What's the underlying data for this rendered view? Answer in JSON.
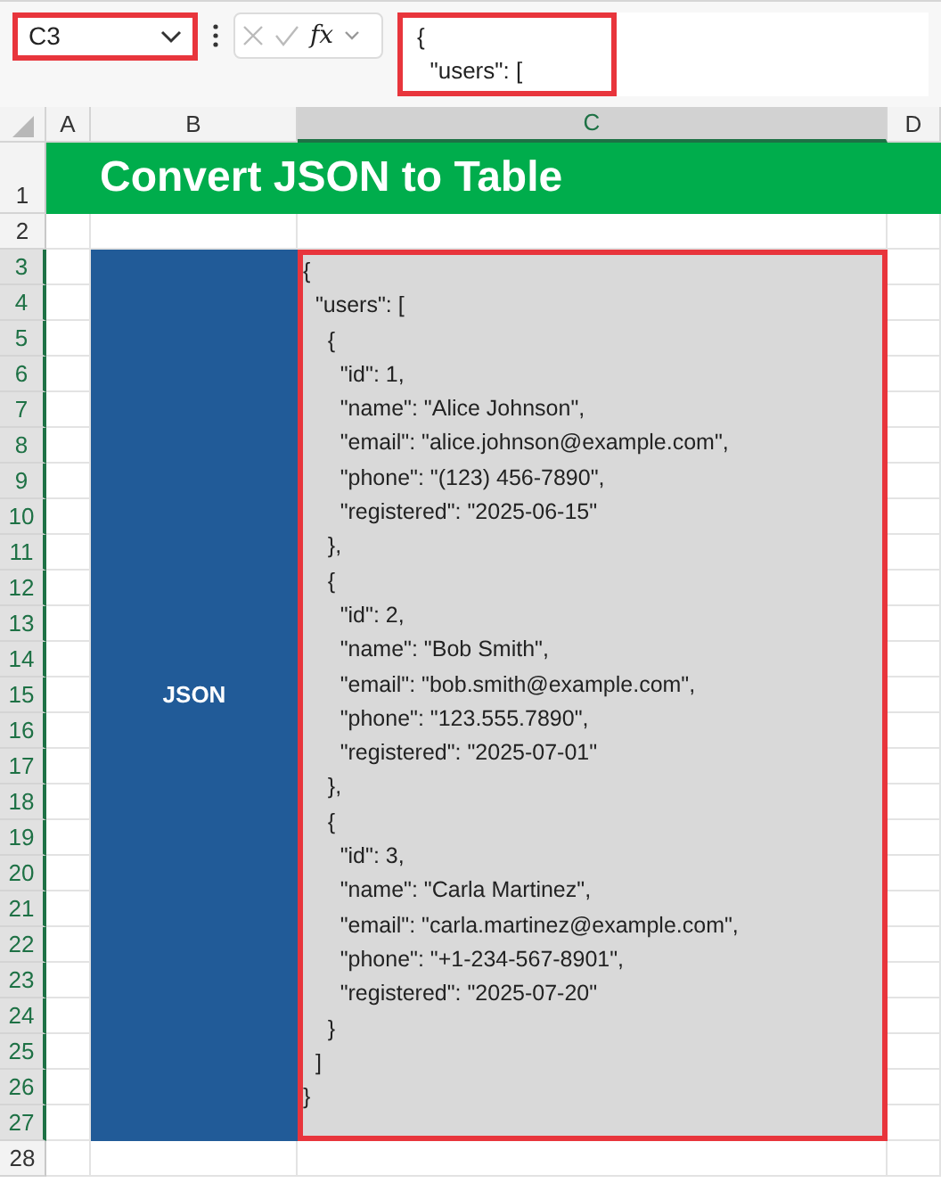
{
  "name_box": {
    "value": "C3"
  },
  "formula_bar": {
    "function_label": "fx",
    "lines": [
      "{",
      "  \"users\": ["
    ]
  },
  "column_headers": [
    {
      "label": "A",
      "selected": false
    },
    {
      "label": "B",
      "selected": false
    },
    {
      "label": "C",
      "selected": true
    },
    {
      "label": "D",
      "selected": false
    }
  ],
  "row_headers": [
    {
      "label": "1",
      "selected": false
    },
    {
      "label": "2",
      "selected": false
    },
    {
      "label": "3",
      "selected": true
    },
    {
      "label": "4",
      "selected": true
    },
    {
      "label": "5",
      "selected": true
    },
    {
      "label": "6",
      "selected": true
    },
    {
      "label": "7",
      "selected": true
    },
    {
      "label": "8",
      "selected": true
    },
    {
      "label": "9",
      "selected": true
    },
    {
      "label": "10",
      "selected": true
    },
    {
      "label": "11",
      "selected": true
    },
    {
      "label": "12",
      "selected": true
    },
    {
      "label": "13",
      "selected": true
    },
    {
      "label": "14",
      "selected": true
    },
    {
      "label": "15",
      "selected": true
    },
    {
      "label": "16",
      "selected": true
    },
    {
      "label": "17",
      "selected": true
    },
    {
      "label": "18",
      "selected": true
    },
    {
      "label": "19",
      "selected": true
    },
    {
      "label": "20",
      "selected": true
    },
    {
      "label": "21",
      "selected": true
    },
    {
      "label": "22",
      "selected": true
    },
    {
      "label": "23",
      "selected": true
    },
    {
      "label": "24",
      "selected": true
    },
    {
      "label": "25",
      "selected": true
    },
    {
      "label": "26",
      "selected": true
    },
    {
      "label": "27",
      "selected": true
    },
    {
      "label": "28",
      "selected": false
    }
  ],
  "title": "Convert JSON to Table",
  "label_cell": "JSON",
  "json_cell": {
    "selected": true,
    "lines": [
      "{",
      "  \"users\": [",
      "    {",
      "      \"id\": 1,",
      "      \"name\": \"Alice Johnson\",",
      "      \"email\": \"alice.johnson@example.com\",",
      "      \"phone\": \"(123) 456-7890\",",
      "      \"registered\": \"2025-06-15\"",
      "    },",
      "    {",
      "      \"id\": 2,",
      "      \"name\": \"Bob Smith\",",
      "      \"email\": \"bob.smith@example.com\",",
      "      \"phone\": \"123.555.7890\",",
      "      \"registered\": \"2025-07-01\"",
      "    },",
      "    {",
      "      \"id\": 3,",
      "      \"name\": \"Carla Martinez\",",
      "      \"email\": \"carla.martinez@example.com\",",
      "      \"phone\": \"+1-234-567-8901\",",
      "      \"registered\": \"2025-07-20\"",
      "    }",
      "  ]",
      "}"
    ]
  }
}
